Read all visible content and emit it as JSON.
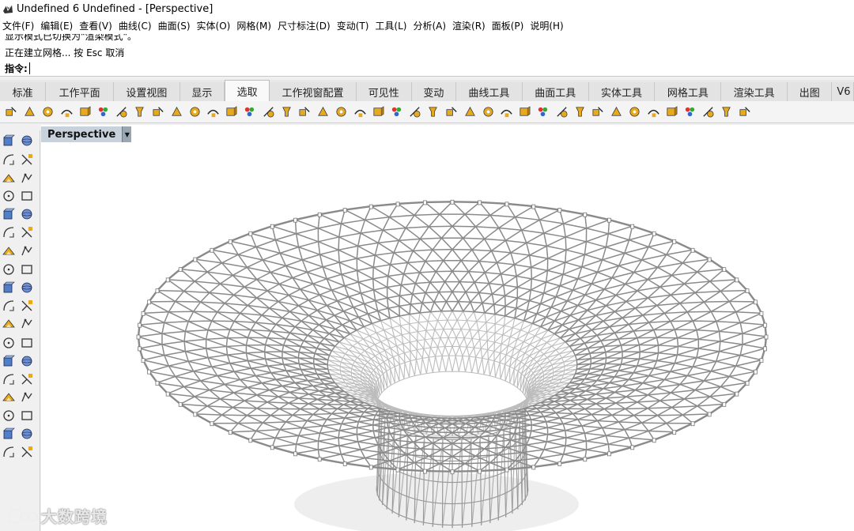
{
  "window": {
    "title": "Undefined 6 Undefined - [Perspective]"
  },
  "menubar": {
    "items": [
      "文件(F)",
      "编辑(E)",
      "查看(V)",
      "曲线(C)",
      "曲面(S)",
      "实体(O)",
      "网格(M)",
      "尺寸标注(D)",
      "变动(T)",
      "工具(L)",
      "分析(A)",
      "渲染(R)",
      "面板(P)",
      "说明(H)"
    ]
  },
  "history": {
    "line1": "显示模式已切换为\"渲染模式\"。",
    "line2": "正在建立网格... 按 Esc 取消"
  },
  "command": {
    "label": "指令:",
    "value": ""
  },
  "tabs": {
    "items": [
      "标准",
      "工作平面",
      "设置视图",
      "显示",
      "选取",
      "工作视窗配置",
      "可见性",
      "变动",
      "曲线工具",
      "曲面工具",
      "实体工具",
      "网格工具",
      "渲染工具",
      "出图",
      "V6"
    ],
    "active_index": 4
  },
  "toolbar": {
    "icons": [
      "select-points-icon",
      "select-curves-icon",
      "select-surfaces-icon",
      "select-polysurfaces-icon",
      "select-last-curve-icon",
      "select-lines-icon",
      "select-annotations-icon",
      "select-blocks-icon",
      "select-color-icon",
      "select-lights-icon",
      "select-point-clouds-icon",
      "select-meshes-icon",
      "select-hatches-icon",
      "select-dots-icon",
      "select-open-icon",
      "select-closed-icon",
      "select-layer-icon",
      "select-material-icon",
      "select-render-icon",
      "select-planar-icon",
      "select-duplicate-icon",
      "select-extrusion-icon",
      "select-polylines-icon",
      "select-arcs-icon",
      "select-circles-icon",
      "select-ellipses-icon",
      "select-named-icon",
      "select-group-icon",
      "select-previous-icon",
      "select-none-icon",
      "select-all-icon",
      "select-invert-icon",
      "select-visible-icon",
      "select-box-icon",
      "select-filter-icon",
      "select-by-id-icon",
      "select-chain-icon",
      "select-brep-icon",
      "select-subd-icon",
      "select-details-icon",
      "select-views-icon"
    ]
  },
  "lefttools": {
    "icons": [
      "select-arrow-icon",
      "point-icon",
      "polyline-icon",
      "curve-icon",
      "circle-icon",
      "arc-icon",
      "polygon-icon",
      "rectangle-icon",
      "ellipse-icon",
      "fillet-icon",
      "surface-from-points-icon",
      "extrude-icon",
      "box-icon",
      "sphere-icon",
      "cylinder-icon",
      "cone-icon",
      "mesh-icon",
      "explode-icon",
      "trim-icon",
      "split-icon",
      "join-icon",
      "group-icon",
      "offset-icon",
      "fillet-edge-icon",
      "text-icon",
      "dimension-icon",
      "array-icon",
      "transform-icon",
      "boolean-icon",
      "dimension-linear-icon",
      "grid-icon",
      "layer-icon",
      "copy-icon",
      "check-icon",
      "render-icon",
      "material-icon"
    ]
  },
  "viewport": {
    "label": "Perspective",
    "dropdown_icon": "dropdown-arrow-icon"
  },
  "watermark": {
    "text": "大数跨境"
  },
  "colors": {
    "viewport_label_bg": "#c8d2dc",
    "active_tab_bg": "#f9f9f9",
    "structure_gray": "#8a8a8a"
  }
}
